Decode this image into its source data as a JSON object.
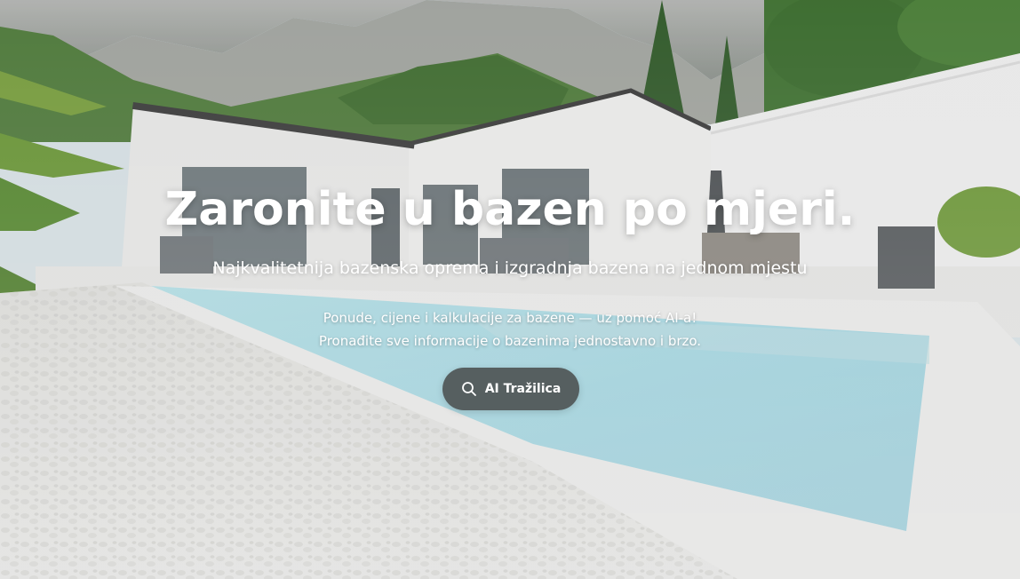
{
  "hero": {
    "headline": "Zaronite u bazen po mjeri.",
    "subheadline": "Najkvalitetnija bazenska oprema i izgradnja bazena na jednom mjestu",
    "tagline_lines": [
      "Ponude, cijene i kalkulacije za bazene — uz pomoć AI-a!",
      "Pronađite sve informacije o bazenima jednostavno i brzo."
    ],
    "cta": {
      "label": "AI Tražilica",
      "icon": "search-icon"
    },
    "background_image": "pool-villa-mountains-photo"
  },
  "colors": {
    "text": "#ffffff",
    "button_bg": "#464a4a",
    "pool_water": "#9fd9e6",
    "sky": "#cfe5f2"
  }
}
